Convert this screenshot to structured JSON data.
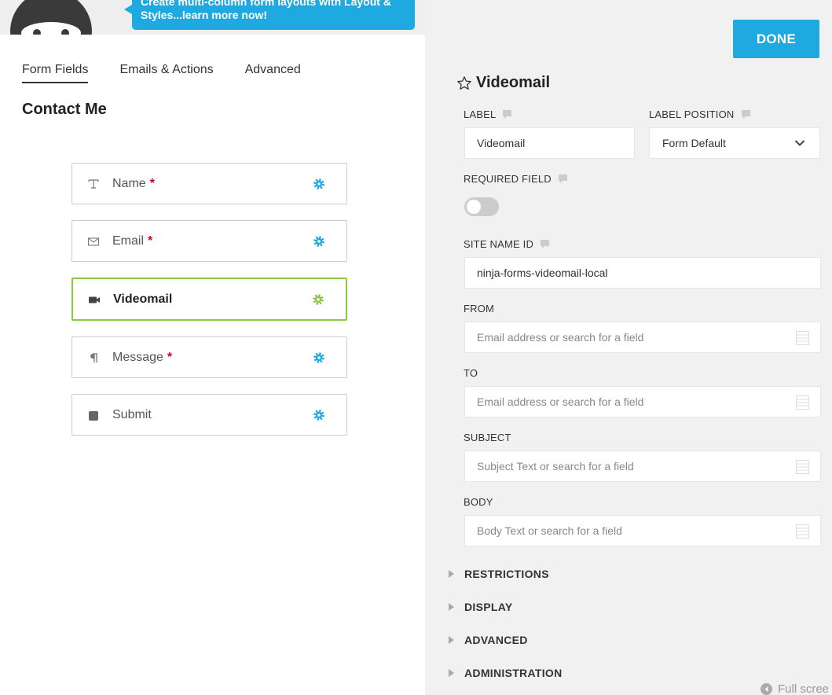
{
  "promo": {
    "text": "Create multi-column form layouts with Layout & Styles...learn more now!"
  },
  "tabs": [
    {
      "label": "Form Fields",
      "active": true
    },
    {
      "label": "Emails & Actions",
      "active": false
    },
    {
      "label": "Advanced",
      "active": false
    }
  ],
  "form": {
    "title": "Contact Me"
  },
  "fields": [
    {
      "label": "Name",
      "required": "*",
      "icon": "text-icon"
    },
    {
      "label": "Email",
      "required": "*",
      "icon": "envelope-icon"
    },
    {
      "label": "Videomail",
      "required": "",
      "icon": "video-camera-icon"
    },
    {
      "label": "Message",
      "required": "*",
      "icon": "paragraph-icon"
    },
    {
      "label": "Submit",
      "required": "",
      "icon": "square-icon"
    }
  ],
  "drawer": {
    "done_label": "DONE",
    "title": "Videomail",
    "label_label": "LABEL",
    "label_value": "Videomail",
    "label_position_label": "LABEL POSITION",
    "label_position_value": "Form Default",
    "required_label": "REQUIRED FIELD",
    "required_on": false,
    "site_name_label": "SITE NAME ID",
    "site_name_value": "ninja-forms-videomail-local",
    "from_label": "FROM",
    "from_placeholder": "Email address or search for a field",
    "to_label": "TO",
    "to_placeholder": "Email address or search for a field",
    "subject_label": "SUBJECT",
    "subject_placeholder": "Subject Text or search for a field",
    "body_label": "BODY",
    "body_placeholder": "Body Text or search for a field",
    "sections": [
      "RESTRICTIONS",
      "DISPLAY",
      "ADVANCED",
      "ADMINISTRATION"
    ],
    "fullscreen_label": "Full scree"
  },
  "colors": {
    "accent": "#1ea9e1",
    "active_field": "#8dc63f",
    "required": "#d0021b"
  }
}
